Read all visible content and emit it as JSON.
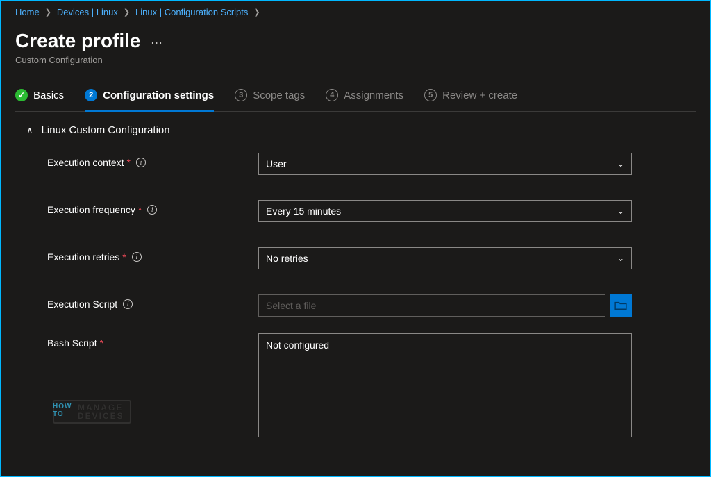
{
  "breadcrumb": [
    {
      "label": "Home"
    },
    {
      "label": "Devices | Linux"
    },
    {
      "label": "Linux | Configuration Scripts"
    }
  ],
  "header": {
    "title": "Create profile",
    "subtitle": "Custom Configuration"
  },
  "tabs": [
    {
      "num": "✓",
      "label": "Basics",
      "state": "done"
    },
    {
      "num": "2",
      "label": "Configuration settings",
      "state": "active"
    },
    {
      "num": "3",
      "label": "Scope tags",
      "state": "pending"
    },
    {
      "num": "4",
      "label": "Assignments",
      "state": "pending"
    },
    {
      "num": "5",
      "label": "Review + create",
      "state": "pending"
    }
  ],
  "section": {
    "title": "Linux Custom Configuration"
  },
  "form": {
    "context": {
      "label": "Execution context",
      "required": true,
      "info": true,
      "value": "User"
    },
    "frequency": {
      "label": "Execution frequency",
      "required": true,
      "info": true,
      "value": "Every 15 minutes"
    },
    "retries": {
      "label": "Execution retries",
      "required": true,
      "info": true,
      "value": "No retries"
    },
    "script": {
      "label": "Execution Script",
      "required": false,
      "info": true,
      "placeholder": "Select a file"
    },
    "bash": {
      "label": "Bash Script",
      "required": true,
      "info": false,
      "value": "Not configured"
    }
  },
  "watermark": {
    "pre1": "HOW",
    "pre2": "TO",
    "line1": "MANAGE",
    "line2": "DEVICES"
  }
}
